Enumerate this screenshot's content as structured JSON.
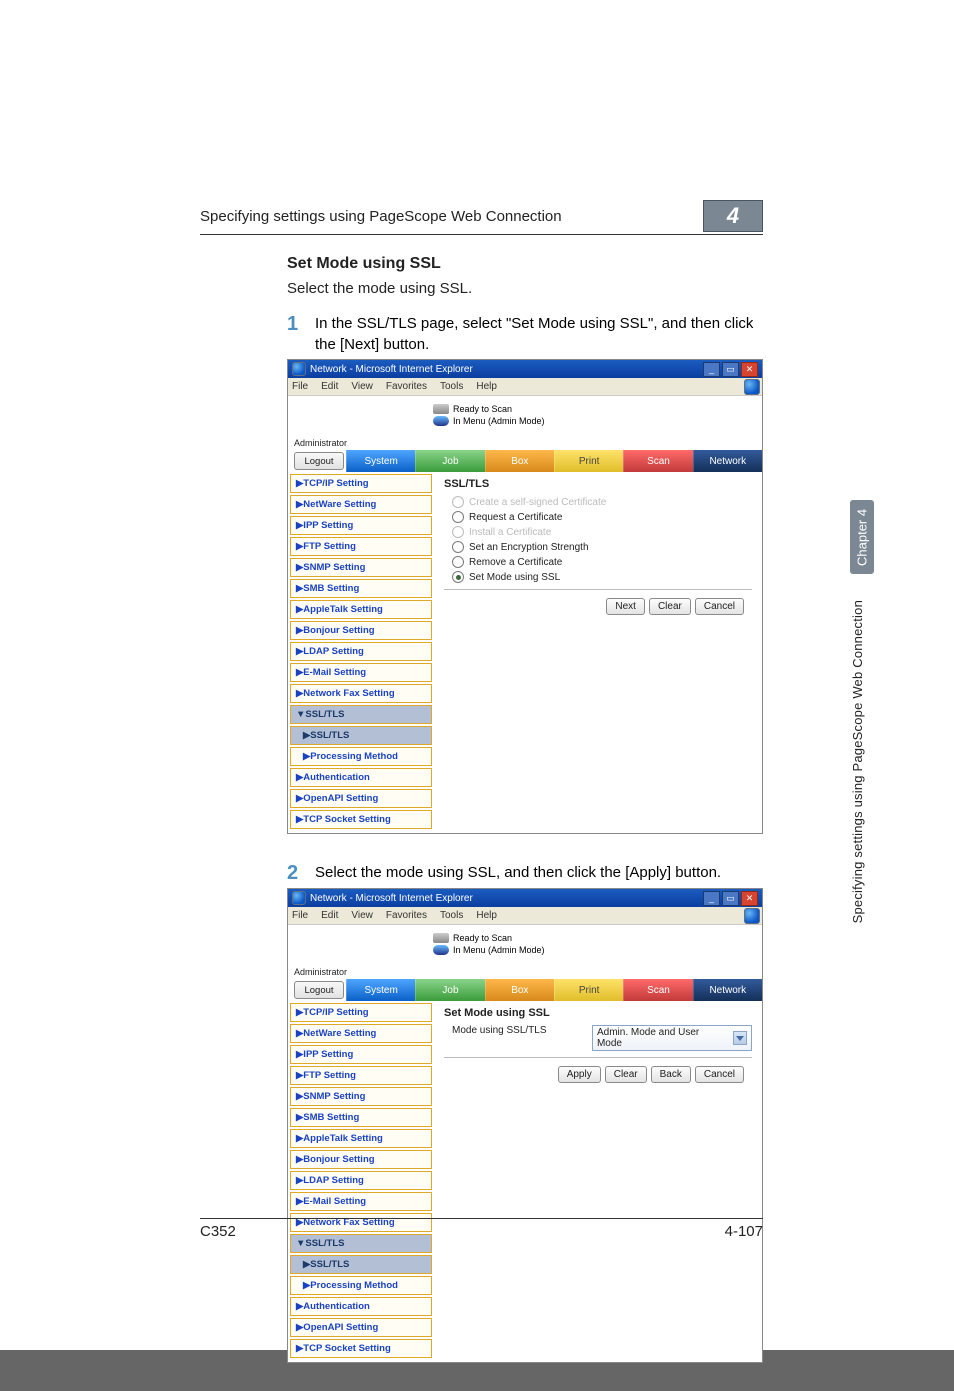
{
  "header": {
    "title": "Specifying settings using PageScope Web Connection",
    "chapter_num": "4"
  },
  "section": {
    "heading": "Set Mode using SSL",
    "intro": "Select the mode using SSL."
  },
  "steps": {
    "s1": {
      "num": "1",
      "text": "In the SSL/TLS page, select \"Set Mode using SSL\", and then click the [Next] button."
    },
    "s2": {
      "num": "2",
      "text": "Select the mode using SSL, and then click the [Apply] button."
    }
  },
  "ie": {
    "title": "Network - Microsoft Internet Explorer",
    "menu": [
      "File",
      "Edit",
      "View",
      "Favorites",
      "Tools",
      "Help"
    ],
    "status1": "Ready to Scan",
    "status2": "In Menu (Admin Mode)",
    "admin": "Administrator",
    "logout": "Logout",
    "tabs": [
      "System",
      "Job",
      "Box",
      "Print",
      "Scan",
      "Network"
    ]
  },
  "sidebar": {
    "items": [
      "▶TCP/IP Setting",
      "▶NetWare Setting",
      "▶IPP Setting",
      "▶FTP Setting",
      "▶SNMP Setting",
      "▶SMB Setting",
      "▶AppleTalk Setting",
      "▶Bonjour Setting",
      "▶LDAP Setting",
      "▶E-Mail Setting",
      "▶Network Fax Setting"
    ],
    "ssl_group": "▼SSL/TLS",
    "ssl_sub": "▶SSL/TLS",
    "proc": "▶Processing Method",
    "tail": [
      "▶Authentication",
      "▶OpenAPI Setting",
      "▶TCP Socket Setting"
    ]
  },
  "panel1": {
    "title": "SSL/TLS",
    "opts": [
      {
        "label": "Create a self-signed Certificate",
        "selected": false,
        "grayed": true
      },
      {
        "label": "Request a Certificate",
        "selected": false,
        "grayed": false
      },
      {
        "label": "Install a Certificate",
        "selected": false,
        "grayed": true
      },
      {
        "label": "Set an Encryption Strength",
        "selected": false,
        "grayed": false
      },
      {
        "label": "Remove a Certificate",
        "selected": false,
        "grayed": false
      },
      {
        "label": "Set Mode using SSL",
        "selected": true,
        "grayed": false
      }
    ],
    "buttons": [
      "Next",
      "Clear",
      "Cancel"
    ]
  },
  "panel2": {
    "title": "Set Mode using SSL",
    "mode_label": "Mode using SSL/TLS",
    "mode_value": "Admin. Mode and User Mode",
    "buttons": [
      "Apply",
      "Clear",
      "Back",
      "Cancel"
    ]
  },
  "side_sticker": {
    "chapter": "Chapter 4",
    "text": "Specifying settings using PageScope Web Connection"
  },
  "footer": {
    "left": "C352",
    "right": "4-107"
  }
}
